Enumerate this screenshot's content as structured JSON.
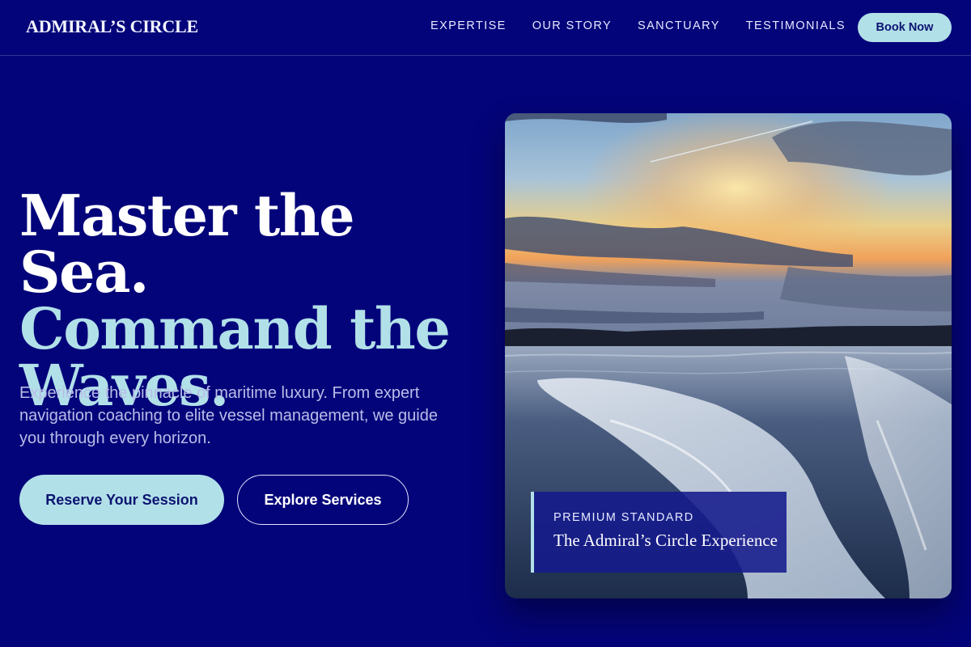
{
  "header": {
    "logo": "ADMIRAL’S CIRCLE",
    "nav": [
      "EXPERTISE",
      "OUR STORY",
      "SANCTUARY",
      "TESTIMONIALS"
    ],
    "cta": "Book Now"
  },
  "hero": {
    "headline_line1": "Master the Sea.",
    "headline_line2": "Command the Waves.",
    "subtext": "Experience the pinnacle of maritime luxury. From expert navigation coaching to elite vessel management, we guide you through every horizon.",
    "primary_button": "Reserve Your Session",
    "secondary_button": "Explore Services"
  },
  "image_card": {
    "eyebrow": "PREMIUM STANDARD",
    "title": "The Admiral’s Circle Experience"
  },
  "colors": {
    "background": "#04047a",
    "accent": "#b2e0e9",
    "accent_text": "#0b1470"
  }
}
